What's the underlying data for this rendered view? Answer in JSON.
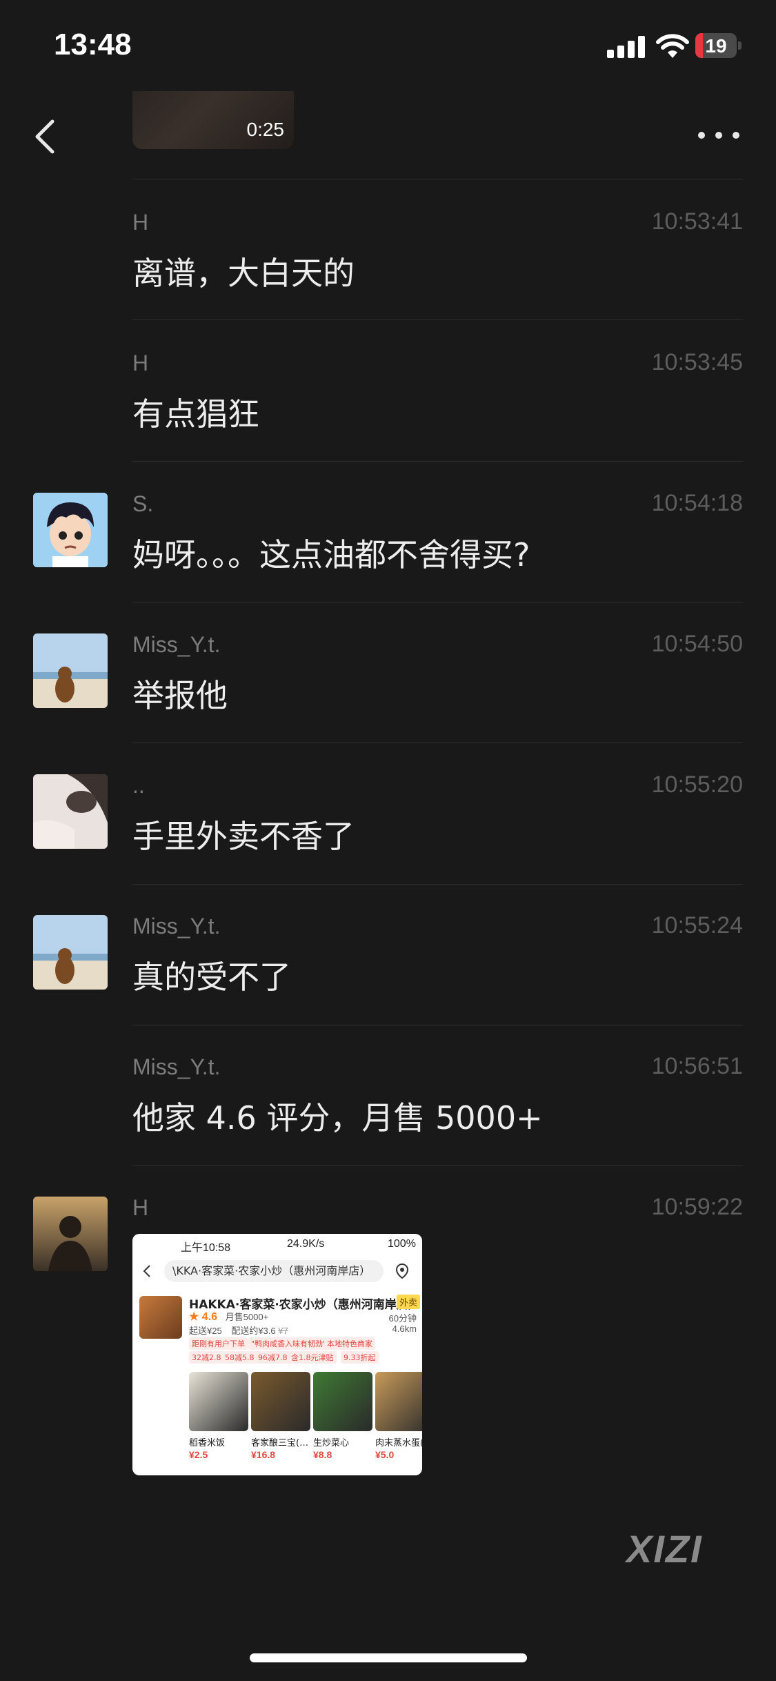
{
  "status_bar": {
    "time": "13:48",
    "battery": "19",
    "battery_level": 0.19
  },
  "header": {
    "back_icon": "chevron-left-icon",
    "more_icon": "ellipsis-icon"
  },
  "video": {
    "duration": "0:25"
  },
  "messages": [
    {
      "name": "H",
      "time": "10:53:41",
      "text": "离谱，大白天的",
      "avatar": ""
    },
    {
      "name": "H",
      "time": "10:53:45",
      "text": "有点猖狂",
      "avatar": ""
    },
    {
      "name": "S.",
      "time": "10:54:18",
      "text": "妈呀。。。这点油都不舍得买?",
      "avatar": "cartoon-boy"
    },
    {
      "name": "Miss_Y.t.",
      "time": "10:54:50",
      "text": "举报他",
      "avatar": "dog-beach"
    },
    {
      "name": "..",
      "time": "10:55:20",
      "text": "手里外卖不香了",
      "avatar": "girl-bed"
    },
    {
      "name": "Miss_Y.t.",
      "time": "10:55:24",
      "text": "真的受不了",
      "avatar": "dog-beach"
    },
    {
      "name": "Miss_Y.t.",
      "time": "10:56:51",
      "text": "他家 4.6 评分，月售 5000+",
      "avatar": ""
    },
    {
      "name": "H",
      "time": "10:59:22",
      "text": "",
      "avatar": "sunset-silhouette"
    }
  ],
  "image_message": {
    "status_time": "上午10:58",
    "status_speed": "24.9K/s",
    "status_battery": "100%",
    "search_text": "\\KKA·客家菜·农家小炒（惠州河南岸店）",
    "shop_name": "HAKKA·客家菜·农家小炒（惠州河南岸店）",
    "shop_tag": "外卖",
    "rating": "★ 4.6",
    "monthly_sales": "月售5000+",
    "delivery_min": "起送¥25",
    "delivery_fee": "配送约¥3.6",
    "delivery_fee_old": "¥7",
    "delivery_time": "60分钟",
    "distance": "4.6km",
    "promos_row1": [
      "距刚有用户下单",
      "\"鸭肉咸香入味有韧劲\"",
      "本地特色商家"
    ],
    "promos_row2": [
      "32减2.8",
      "58减5.8",
      "96减7.8",
      "含1.8元津贴",
      "9.33折起"
    ],
    "dishes": [
      {
        "name": "稻香米饭",
        "price": "¥2.5",
        "color": "#e9e4d8"
      },
      {
        "name": "客家酿三宝(…",
        "price": "¥16.8",
        "color": "#7a5a2e"
      },
      {
        "name": "生炒菜心",
        "price": "¥8.8",
        "color": "#3f7a34"
      },
      {
        "name": "肉末蒸水蛋(…",
        "price": "¥5.0",
        "color": "#c89b5a"
      }
    ]
  },
  "watermark": "XIZI"
}
